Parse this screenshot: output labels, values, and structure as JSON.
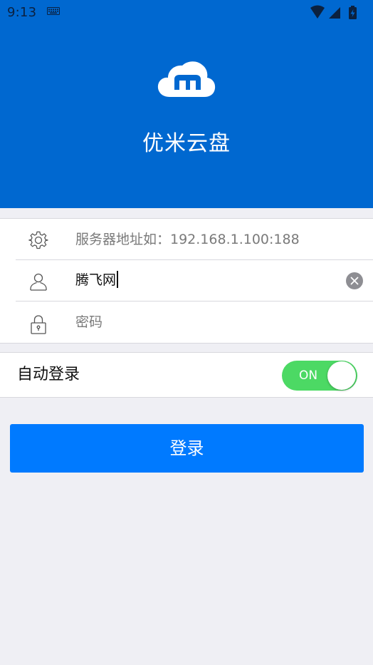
{
  "status_bar": {
    "time": "9:13",
    "icons": [
      "keyboard-icon",
      "wifi-icon",
      "signal-icon",
      "battery-charging-icon"
    ]
  },
  "header": {
    "app_title": "优米云盘",
    "logo": "cloud-m-logo",
    "background_color": "#0068d0"
  },
  "form": {
    "server": {
      "icon": "gear-icon",
      "value": "",
      "placeholder": "服务器地址如：192.168.1.100:188"
    },
    "username": {
      "icon": "user-icon",
      "value": "腾飞网",
      "placeholder": ""
    },
    "password": {
      "icon": "lock-icon",
      "value": "",
      "placeholder": "密码"
    }
  },
  "auto_login": {
    "label": "自动登录",
    "toggle_text": "ON",
    "enabled": true,
    "toggle_color": "#4cd964"
  },
  "login_button": {
    "label": "登录",
    "color": "#007aff"
  }
}
